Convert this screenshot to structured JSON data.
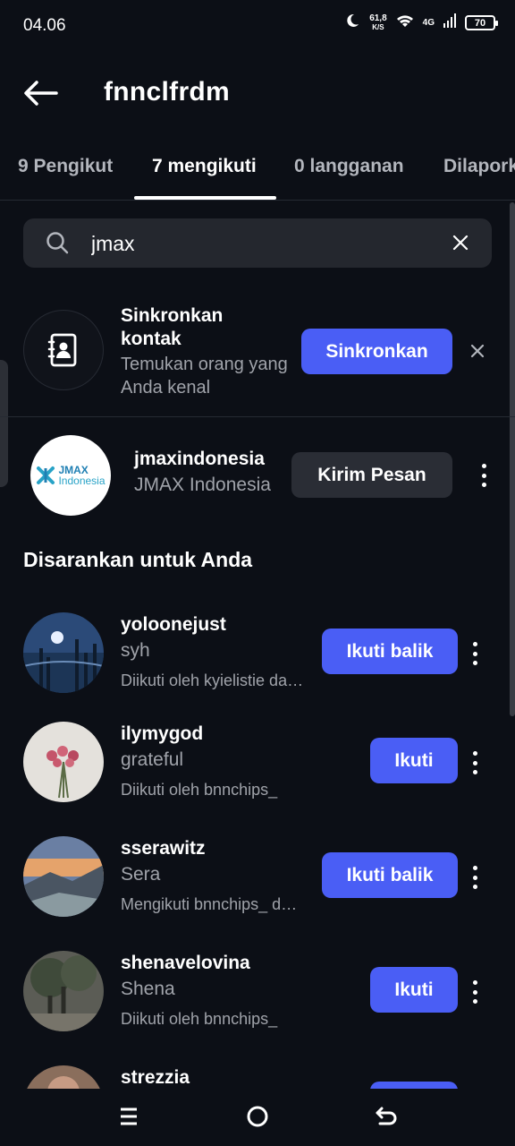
{
  "status_bar": {
    "time": "04.06",
    "net_speed_value": "61,8",
    "net_speed_unit": "K/S",
    "network_type": "4G",
    "battery": "70"
  },
  "header": {
    "title": "fnnclfrdm"
  },
  "tabs": [
    {
      "label": "9 Pengikut",
      "active": false
    },
    {
      "label": "7 mengikuti",
      "active": true
    },
    {
      "label": "0 langganan",
      "active": false
    },
    {
      "label": "Dilaporkan",
      "active": false
    }
  ],
  "search": {
    "value": "jmax"
  },
  "sync_contacts": {
    "title": "Sinkronkan kontak",
    "subtitle": "Temukan orang yang Anda kenal",
    "button_label": "Sinkronkan"
  },
  "search_result": {
    "username": "jmaxindonesia",
    "display_name": "JMAX Indonesia",
    "logo_line1": "JMAX",
    "logo_line2": "Indonesia",
    "button_label": "Kirim Pesan"
  },
  "suggested": {
    "title": "Disarankan untuk Anda",
    "items": [
      {
        "username": "yoloonejust",
        "name": "syh",
        "info": "Diikuti oleh kyielistie dan lainnya",
        "button": "Ikuti balik"
      },
      {
        "username": "ilymygod",
        "name": "grateful",
        "info": "Diikuti oleh bnnchips_",
        "button": "Ikuti"
      },
      {
        "username": "sserawitz",
        "name": "Sera",
        "info": "Mengikuti bnnchips_ dan lainnya",
        "button": "Ikuti balik"
      },
      {
        "username": "shenavelovina",
        "name": "Shena",
        "info": "Diikuti oleh bnnchips_",
        "button": "Ikuti"
      },
      {
        "username": "strezzia",
        "name": "",
        "info": "",
        "button": ""
      }
    ]
  },
  "colors": {
    "background": "#0c0f16",
    "accent": "#4a5ef5",
    "secondary_button": "#2a2d35",
    "muted_text": "#a0a3aa"
  }
}
